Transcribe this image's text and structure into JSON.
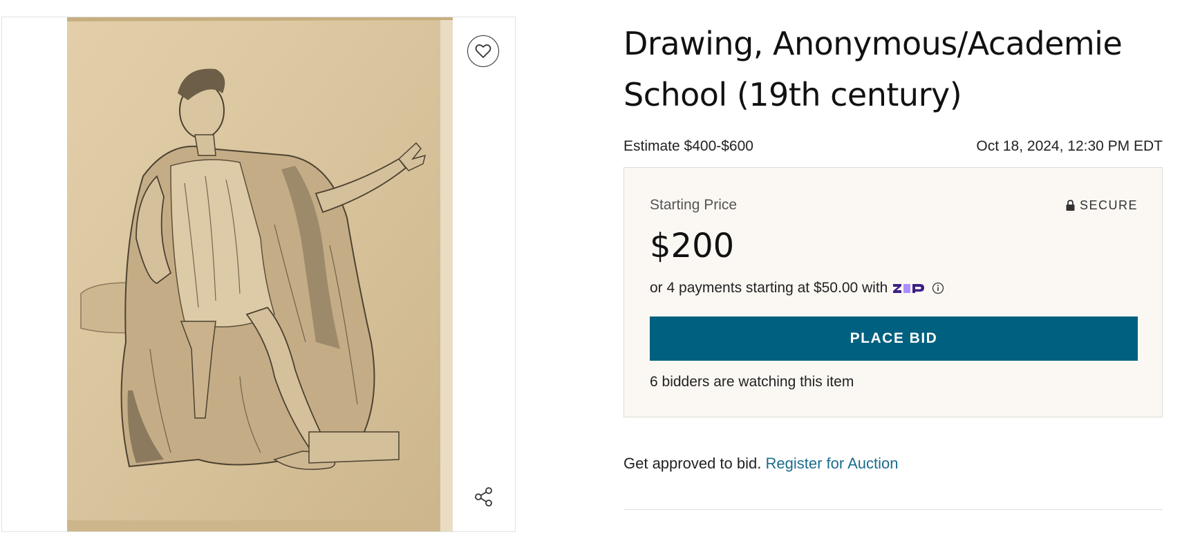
{
  "lot": {
    "title_line1": "Drawing, Anonymous/Academie",
    "title_line2": "School (19th century)",
    "estimate": "Estimate $400-$600",
    "sale_date": "Oct 18, 2024, 12:30 PM EDT"
  },
  "image": {
    "favorite_icon": "heart-icon",
    "share_icon": "share-icon"
  },
  "bid_box": {
    "starting_label": "Starting Price",
    "secure_label": "SECURE",
    "price": "$200",
    "installments_text": "or 4 payments starting at $50.00 with",
    "zip_brand": "zip",
    "place_bid_label": "PLACE BID",
    "watching_text": "6 bidders are watching this item"
  },
  "register": {
    "prompt": "Get approved to bid.",
    "link_label": "Register for Auction"
  },
  "colors": {
    "primary_button": "#00607f",
    "link": "#1c6c8c",
    "bid_box_background": "#fbf8f4",
    "zip_purple": "#3d1f84",
    "zip_accent": "#aa8fff"
  }
}
